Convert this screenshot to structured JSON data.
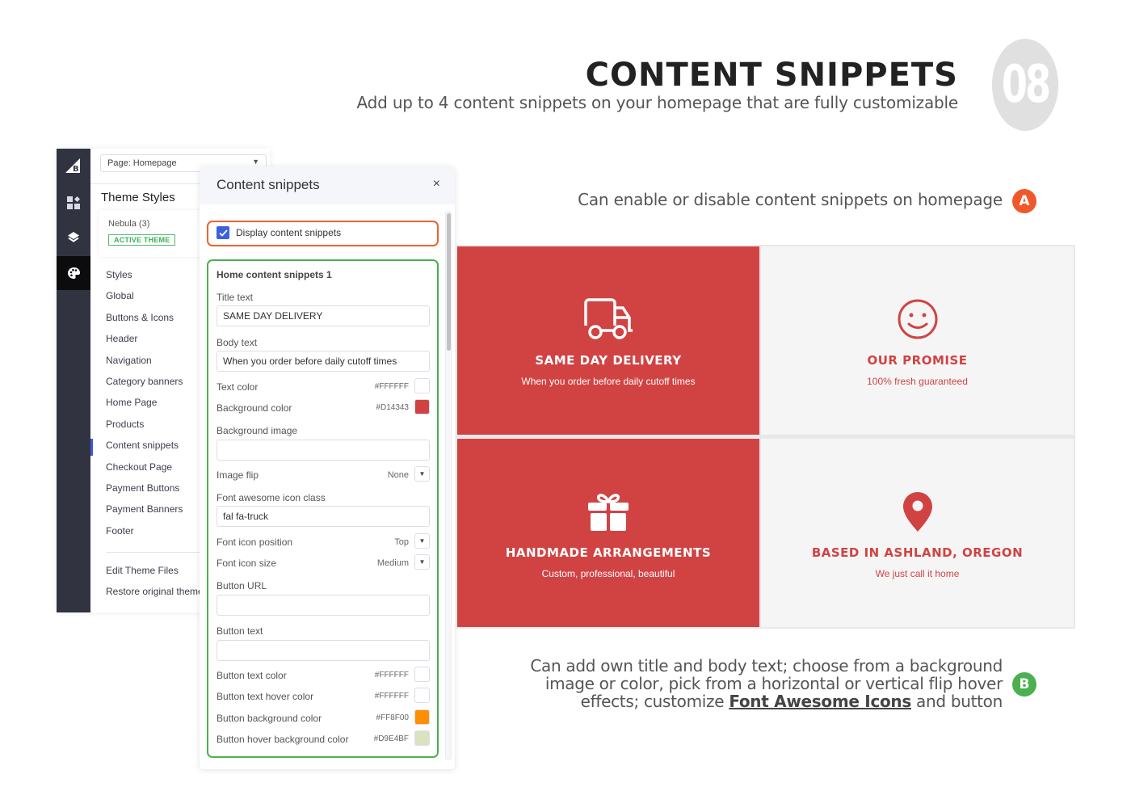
{
  "header": {
    "title": "CONTENT SNIPPETS",
    "subtitle": "Add up to 4 content snippets on your homepage that are fully customizable",
    "section_number": "08"
  },
  "editor": {
    "rail_icons": [
      "bigcommerce-logo-icon",
      "widgets-icon",
      "layers-icon",
      "palette-icon"
    ],
    "page_select": "Page: Homepage",
    "section_title": "Theme Styles",
    "theme_name": "Nebula (3)",
    "theme_badge": "ACTIVE THEME",
    "nav_items": [
      {
        "label": "Styles"
      },
      {
        "label": "Global"
      },
      {
        "label": "Buttons & Icons"
      },
      {
        "label": "Header"
      },
      {
        "label": "Navigation"
      },
      {
        "label": "Category banners"
      },
      {
        "label": "Home Page"
      },
      {
        "label": "Products"
      },
      {
        "label": "Content snippets",
        "active": true
      },
      {
        "label": "Checkout Page"
      },
      {
        "label": "Payment Buttons"
      },
      {
        "label": "Payment Banners"
      },
      {
        "label": "Footer"
      }
    ],
    "footer_items": [
      {
        "label": "Edit Theme Files"
      },
      {
        "label": "Restore original theme"
      }
    ]
  },
  "panel": {
    "title": "Content snippets",
    "close_icon": "×",
    "display_checkbox": {
      "label": "Display content snippets",
      "checked": true
    },
    "snippet": {
      "title": "Home content snippets 1",
      "title_text_label": "Title text",
      "title_text_value": "SAME DAY DELIVERY",
      "body_text_label": "Body text",
      "body_text_value": "When you order before daily cutoff times",
      "text_color_label": "Text color",
      "text_color": "#FFFFFF",
      "bg_color_label": "Background color",
      "bg_color": "#D14343",
      "bg_image_label": "Background image",
      "bg_image_value": "",
      "image_flip_label": "Image flip",
      "image_flip_value": "None",
      "icon_class_label": "Font awesome icon class",
      "icon_class_value": "fal fa-truck",
      "icon_position_label": "Font icon position",
      "icon_position_value": "Top",
      "icon_size_label": "Font icon size",
      "icon_size_value": "Medium",
      "button_url_label": "Button URL",
      "button_url_value": "",
      "button_text_label": "Button text",
      "button_text_value": "",
      "button_text_color_label": "Button text color",
      "button_text_color": "#FFFFFF",
      "button_text_hover_label": "Button text hover color",
      "button_text_hover_color": "#FFFFFF",
      "button_bg_label": "Button background color",
      "button_bg_color": "#FF8F00",
      "button_hover_bg_label": "Button hover background color",
      "button_hover_bg_color": "#D9E4BF"
    }
  },
  "annotations": {
    "a_badge": "A",
    "a_text": "Can enable or disable content snippets on homepage",
    "b_badge": "B",
    "b_text_1": "Can add own title and body text; choose from a background image or color, pick from a horizontal or vertical flip hover effects; customize ",
    "b_link": "Font Awesome Icons",
    "b_text_2": " and button"
  },
  "preview": {
    "tiles": [
      {
        "icon": "truck-icon",
        "title": "SAME DAY DELIVERY",
        "body": "When you order before daily cutoff times",
        "style": "red"
      },
      {
        "icon": "smile-icon",
        "title": "OUR PROMISE",
        "body": "100% fresh guaranteed",
        "style": "light"
      },
      {
        "icon": "gift-icon",
        "title": "HANDMADE ARRANGEMENTS",
        "body": "Custom, professional, beautiful",
        "style": "red"
      },
      {
        "icon": "map-marker-icon",
        "title": "BASED IN ASHLAND, OREGON",
        "body": "We just call it home",
        "style": "light"
      }
    ]
  },
  "colors": {
    "accent_red": "#D14343",
    "badge_orange": "#F0582A",
    "badge_green": "#4CAF50",
    "checkbox_blue": "#3D60DB"
  }
}
